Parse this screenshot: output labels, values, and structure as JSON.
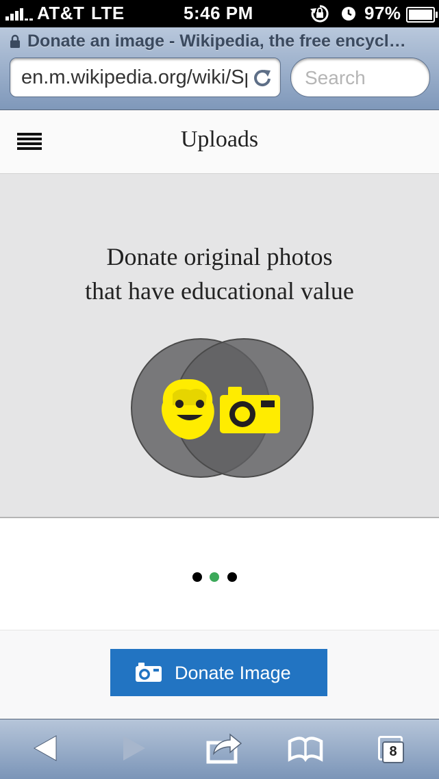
{
  "status_bar": {
    "carrier": "AT&T",
    "network": "LTE",
    "time": "5:46 PM",
    "battery": "97%",
    "battery_level": 0.97
  },
  "browser": {
    "page_title": "Donate an image - Wikipedia, the free encycl…",
    "url": "en.m.wikipedia.org/wiki/Special:Uploads",
    "search_placeholder": "Search",
    "tab_count": "8"
  },
  "header": {
    "title": "Uploads",
    "menu_icon": "hamburger-menu-icon"
  },
  "hero": {
    "line1": "Donate original photos",
    "line2": "that have educational value",
    "icons": [
      "face-icon",
      "camera-icon"
    ],
    "accent_color": "#ffec00"
  },
  "carousel": {
    "page_count": 3,
    "active_index": 1,
    "active_color": "#3ca95a"
  },
  "action": {
    "donate_label": "Donate Image",
    "button_color": "#2274c2"
  },
  "toolbar": {
    "icons": [
      "back-icon",
      "forward-icon",
      "share-icon",
      "bookmarks-icon",
      "tabs-icon"
    ]
  }
}
